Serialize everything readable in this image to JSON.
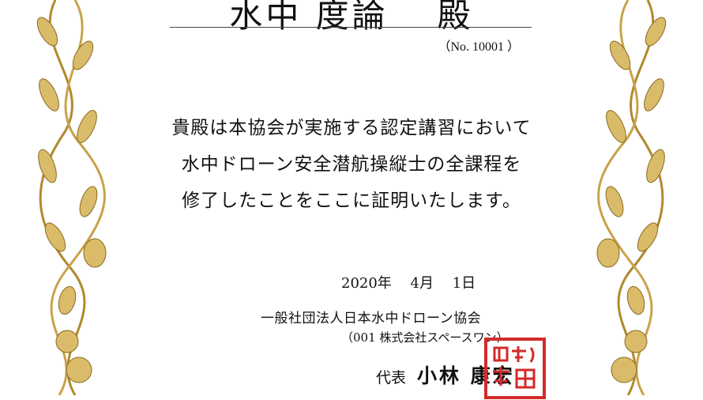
{
  "certificate": {
    "recipient_name": "水中 度論",
    "honorific": "殿",
    "number": "（No. 10001 ）",
    "body_lines": [
      "貴殿は本協会が実施する認定講習において",
      "水中ドローン安全潜航操縦士の全課程を",
      "修了したことをここに証明いたします。"
    ],
    "date": "2020年　 4月　 1日",
    "organization": "一般社団法人日本水中ドローン協会",
    "organization_sub": "（001 株式会社スペースワン）",
    "representative_title": "代表",
    "representative_name": "小林 康宏"
  },
  "colors": {
    "border_gold": "#b08a2c",
    "border_gold_light": "#d9bb6a",
    "seal_red": "#d42a2a"
  },
  "icons": {
    "border": "ornamental-vine-border",
    "seal": "red-personal-seal"
  }
}
